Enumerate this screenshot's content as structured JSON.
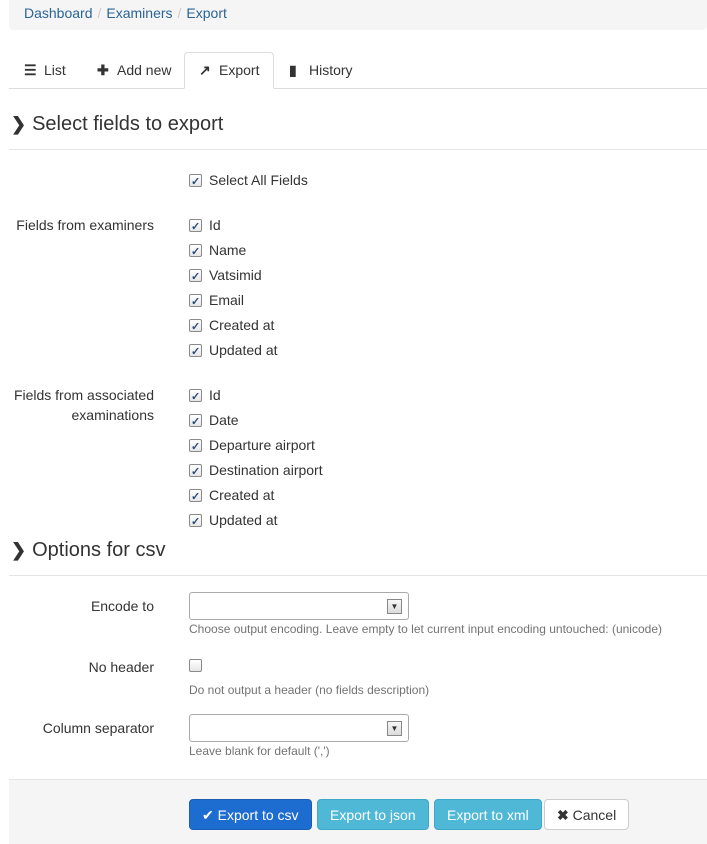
{
  "breadcrumb": {
    "items": [
      "Dashboard",
      "Examiners",
      "Export"
    ],
    "separator": "/"
  },
  "tabs": [
    {
      "label": "List",
      "icon": "list-icon"
    },
    {
      "label": "Add new",
      "icon": "plus-icon"
    },
    {
      "label": "Export",
      "icon": "share-icon"
    },
    {
      "label": "History",
      "icon": "book-icon"
    }
  ],
  "sections": {
    "select_fields": "Select fields to export",
    "options_csv": "Options for csv"
  },
  "select_all_label": "Select All Fields",
  "examiners": {
    "group_label": "Fields from examiners",
    "fields": [
      "Id",
      "Name",
      "Vatsimid",
      "Email",
      "Created at",
      "Updated at"
    ]
  },
  "examinations": {
    "group_label_line1": "Fields from associated",
    "group_label_line2": "examinations",
    "fields": [
      "Id",
      "Date",
      "Departure airport",
      "Destination airport",
      "Created at",
      "Updated at"
    ]
  },
  "csv_options": {
    "encode_label": "Encode to",
    "encode_value": "",
    "encode_help": "Choose output encoding. Leave empty to let current input encoding untouched: (unicode)",
    "no_header_label": "No header",
    "no_header_help": "Do not output a header (no fields description)",
    "separator_label": "Column separator",
    "separator_value": "",
    "separator_help": "Leave blank for default (',')"
  },
  "buttons": {
    "csv": "Export to csv",
    "json": "Export to json",
    "xml": "Export to xml",
    "cancel": "Cancel"
  },
  "colors": {
    "link": "#2a6496",
    "primary": "#1d6dd1",
    "info": "#4fb8d6"
  }
}
